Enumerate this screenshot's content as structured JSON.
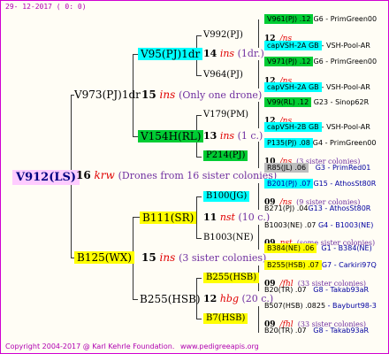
{
  "header": "29- 12-2017 (  0:  0)",
  "footer": {
    "copyright": "Copyright 2004-2017 @ Karl Kehrle Foundation.",
    "url": "www.pedigreeapis.org"
  },
  "root": {
    "name": "V912(LS)",
    "num": "16",
    "cls": "krw",
    "note": "(Drones from 16 sister colonies)"
  },
  "gen1": [
    {
      "name": "V973(PJ)1dr",
      "num": "15",
      "cls": "ins",
      "note": "(Only one drone)"
    },
    {
      "name": "B125(WX)",
      "num": "15",
      "cls": "ins",
      "note": "(3 sister colonies)"
    }
  ],
  "gen2": [
    {
      "name": "V95(PJ)1dr",
      "num": "14",
      "cls": "ins",
      "note": "(1dr.)"
    },
    {
      "name": "V154H(RL)",
      "num": "13",
      "cls": "ins",
      "note": "(1 c.)"
    },
    {
      "name": "B111(SR)",
      "num": "11",
      "cls": "nst",
      "note": "(10 c.)"
    },
    {
      "name": "B255(HSB)",
      "num": "12",
      "cls": "hbg",
      "note": "(20 c.)"
    }
  ],
  "gen3": [
    {
      "name": "V992(PJ)"
    },
    {
      "name": "V964(PJ)"
    },
    {
      "name": "V179(PM)"
    },
    {
      "name": "P214(PJ)"
    },
    {
      "name": "B100(JG)"
    },
    {
      "name": "B1003(NE)"
    },
    {
      "name": "B255(HSB)"
    },
    {
      "name": "B7(HSB)"
    }
  ],
  "gen4": [
    {
      "name": "V961(PJ) .12",
      "src": "G6 - PrimGreen00"
    },
    {
      "num": "12",
      "cls": "/ns"
    },
    {
      "name": "capVSH-2A GB",
      "src": "- VSH-Pool-AR"
    },
    {
      "name": "V971(PJ) .12",
      "src": "G6 - PrimGreen00"
    },
    {
      "num": "12",
      "cls": "/ns"
    },
    {
      "name": "capVSH-2A GB",
      "src": "- VSH-Pool-AR"
    },
    {
      "name": "V99(RL) .12",
      "src": "G23 - Sinop62R"
    },
    {
      "num": "12",
      "cls": "/ns"
    },
    {
      "name": "capVSH-2B GB",
      "src": "- VSH-Pool-AR"
    },
    {
      "name": "P135(PJ) .08",
      "src": "G4 - PrimGreen00"
    },
    {
      "num": "10",
      "cls": "/ns",
      "note": "(3 sister colonies)"
    },
    {
      "name": "R85(JL) .06",
      "src": "G3 - PrimRed01"
    },
    {
      "name": "B201(PJ) .07",
      "src": "G15 - AthosSt80R"
    },
    {
      "num": "09",
      "cls": "/ns",
      "note": "(9 sister colonies)"
    },
    {
      "name": "B271(PJ) .04",
      "src": "G13 - AthosSt80R"
    },
    {
      "name": "B1003(NE) .07",
      "src": "G4 - B1003(NE)"
    },
    {
      "num": "09",
      "cls": "nst",
      "note": "(some sister colonies)"
    },
    {
      "name": "B384(NE) .06",
      "src": "G1 - B384(NE)"
    },
    {
      "name": "B255(HSB) .07",
      "src": "G7 - Carkiri97Q"
    },
    {
      "num": "09",
      "cls": "/fhl",
      "note": "(33 sister colonies)"
    },
    {
      "name": "B20(TR) .07",
      "src": "G8 - Takab93aR"
    },
    {
      "name": "B507(HSB) .0825",
      "src": "- Bayburt98-3"
    },
    {
      "num": "09",
      "cls": "/fhl",
      "note": "(33 sister colonies)"
    },
    {
      "name": "B20(TR) .07",
      "src": "G8 - Takab93aR"
    }
  ],
  "colors": {
    "yellow": "#ffff00",
    "cyan": "#00ffff",
    "green": "#00cc33",
    "grey": "#bdbdbd",
    "root": "#ffccff",
    "class": "#e00000",
    "note": "#7030a0"
  }
}
